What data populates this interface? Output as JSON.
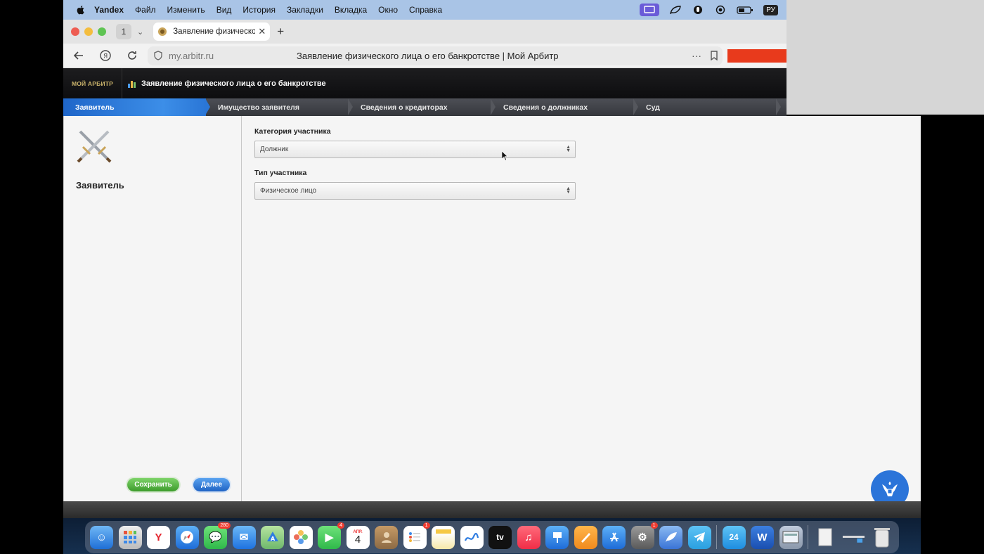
{
  "menubar": {
    "app": "Yandex",
    "items": [
      "Файл",
      "Изменить",
      "Вид",
      "История",
      "Закладки",
      "Вкладка",
      "Окно",
      "Справка"
    ],
    "lang": "РУ"
  },
  "tabbar": {
    "tab_count": "1",
    "tab_title": "Заявление физическог",
    "new_tab": "+"
  },
  "address": {
    "host": "my.arbitr.ru",
    "page_title": "Заявление физического лица о его банкротстве | Мой Арбитр",
    "more": "···"
  },
  "site": {
    "logo": "МОЙ АРБИТР",
    "header_title": "Заявление физического лица о его банкротстве"
  },
  "steps": [
    {
      "label": "Заявитель",
      "active": true
    },
    {
      "label": "Имущество заявителя",
      "active": false
    },
    {
      "label": "Сведения о кредиторах",
      "active": false
    },
    {
      "label": "Сведения о должниках",
      "active": false
    },
    {
      "label": "Суд",
      "active": false
    }
  ],
  "left": {
    "title": "Заявитель",
    "save": "Сохранить",
    "next": "Далее"
  },
  "form": {
    "category_label": "Категория участника",
    "category_value": "Должник",
    "type_label": "Тип участника",
    "type_value": "Физическое лицо"
  },
  "dock": {
    "messages_badge": "280",
    "facetime_badge": "4",
    "calendar_month": "АПР.",
    "calendar_day": "4",
    "reminders_badge": "1",
    "settings_badge": "1",
    "tv_label": "tv",
    "calendar24": "24"
  },
  "colors": {
    "menubar": "#a9c4e6",
    "active_step": "#2a76d6",
    "save_btn": "#3c9b2b",
    "next_btn": "#1f63c4",
    "red_bar": "#e83a1c"
  }
}
